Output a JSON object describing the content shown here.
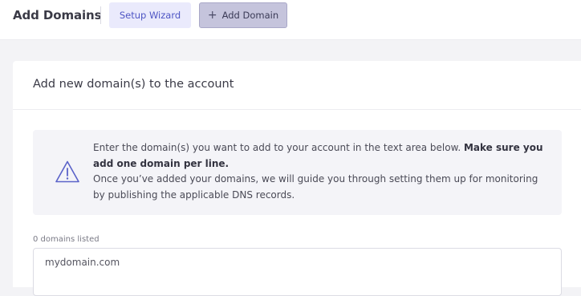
{
  "header": {
    "title": "Add Domains",
    "setup_wizard_label": "Setup Wizard",
    "add_domain_label": "Add Domain",
    "add_domain_icon": "+"
  },
  "card": {
    "title": "Add new domain(s) to the account",
    "info": {
      "icon": "warning-triangle-icon",
      "text_1": "Enter the domain(s) you want to add to your account in the text area below. ",
      "text_bold": "Make sure you add one domain per line.",
      "text_2": "Once you’ve added your domains, we will guide you through setting them up for monitoring by publishing the applicable DNS records."
    },
    "domains_count_label": "0 domains listed",
    "textarea": {
      "value": "",
      "placeholder": "mydomain.com"
    }
  },
  "colors": {
    "accent": "#4e55c4",
    "setup_button_bg": "#eaeafc",
    "add_button_bg": "#c5c4dc",
    "page_bg": "#f3f3f6",
    "info_bg": "#f4f4f8"
  }
}
